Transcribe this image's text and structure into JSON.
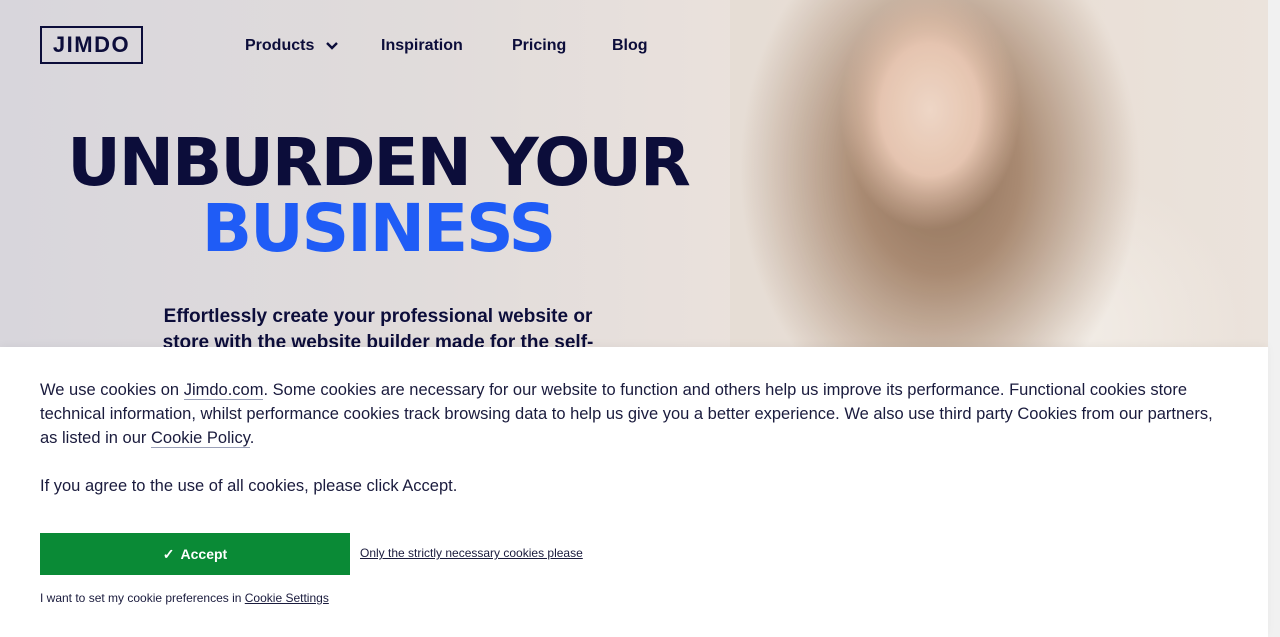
{
  "brand": {
    "logo_text": "JIMDO"
  },
  "nav": {
    "items": [
      {
        "label": "Products",
        "has_dropdown": true
      },
      {
        "label": "Inspiration"
      },
      {
        "label": "Pricing"
      },
      {
        "label": "Blog"
      }
    ]
  },
  "hero": {
    "headline_line1": "UNBURDEN YOUR",
    "headline_line2": "BUSINESS",
    "subtext": "Effortlessly create your professional website or store with the website builder made for the self-",
    "colors": {
      "dark": "#0c0d3a",
      "accent": "#1f5cf6"
    }
  },
  "cookie_banner": {
    "intro_before": "We use cookies on ",
    "site_link": "Jimdo.com",
    "intro_after": ". Some cookies are necessary for our website to function and others help us improve its performance. Functional cookies store technical information, whilst performance cookies track browsing data to help us give you a better experience. We also use third party Cookies from our partners, as listed in our ",
    "policy_link": "Cookie Policy",
    "intro_end": ".",
    "agree_text": "If you agree to the use of all cookies, please click Accept.",
    "accept_check": "✓",
    "accept_label": "Accept",
    "strict_label": "Only the strictly necessary cookies please",
    "prefs_text": "I want to set my cookie preferences in ",
    "settings_link": "Cookie Settings",
    "accept_color": "#0a8a36"
  }
}
